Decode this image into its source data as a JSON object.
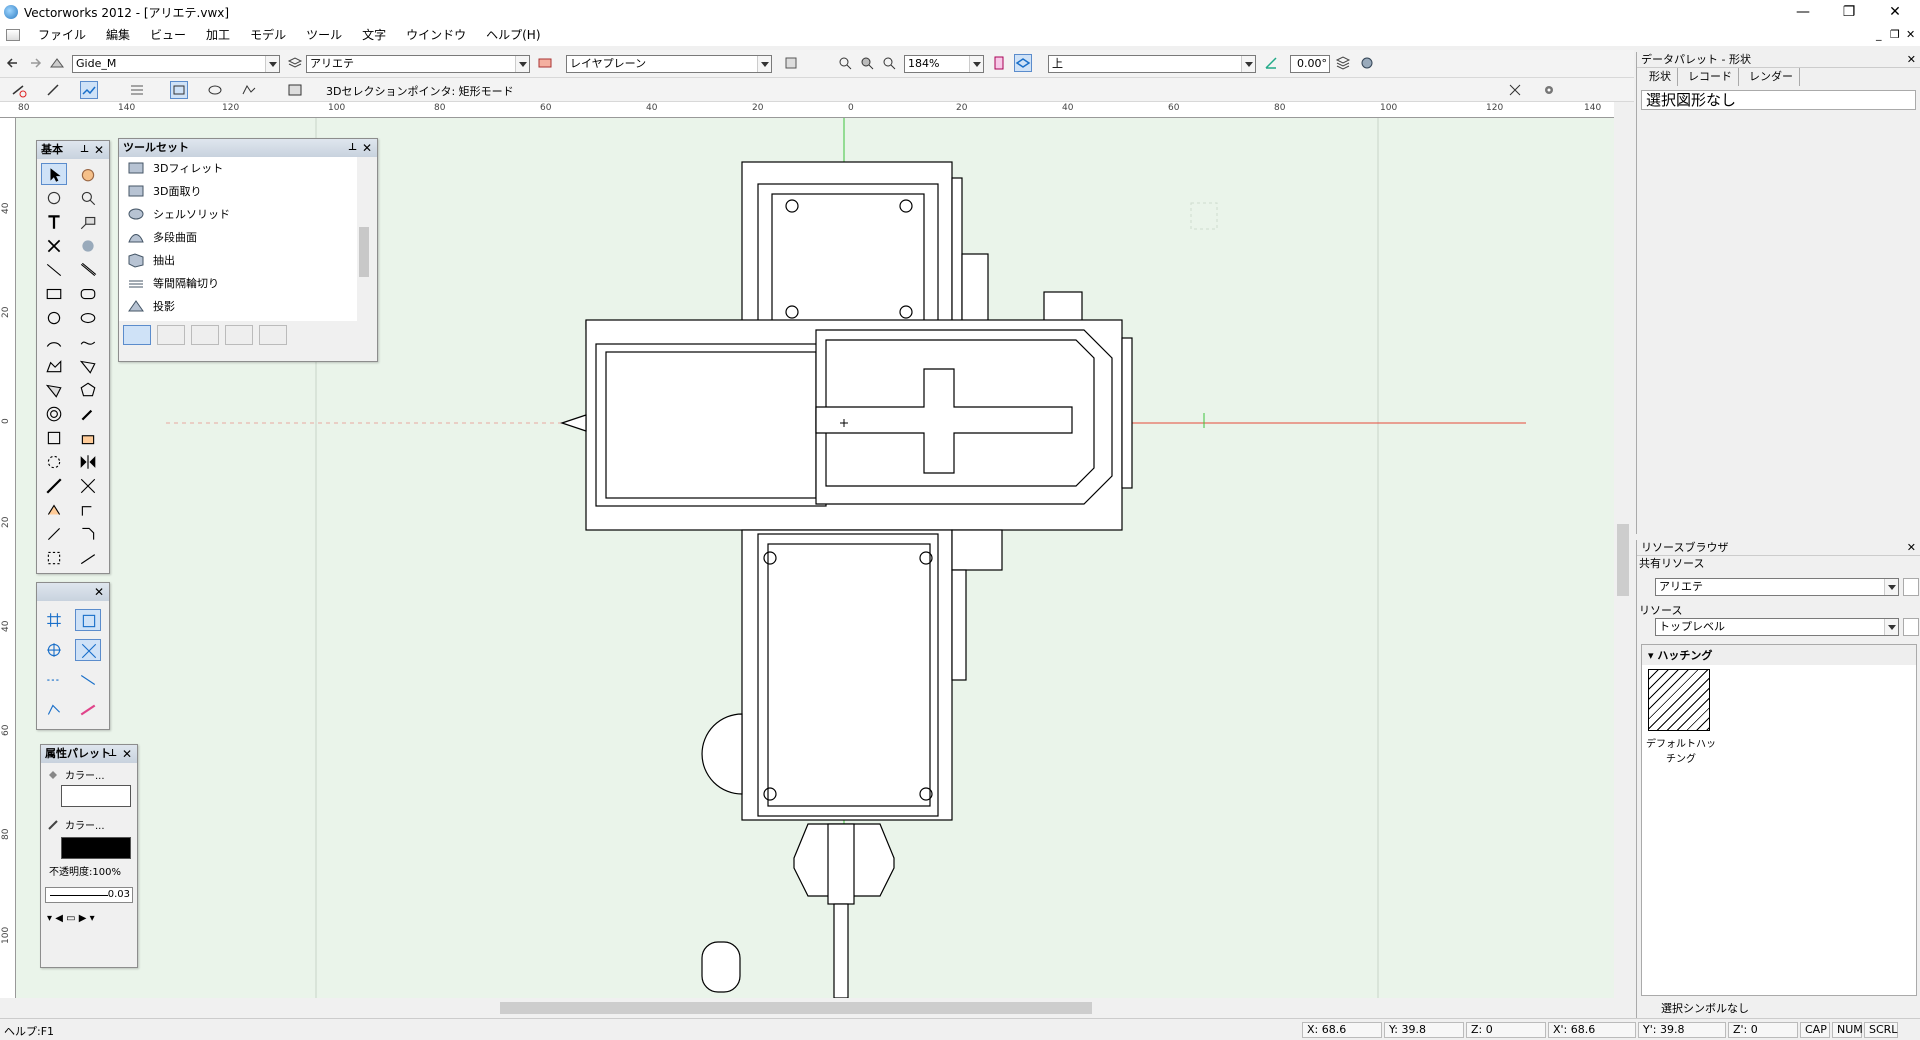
{
  "window": {
    "title": "Vectorworks 2012 - [アリエテ.vwx]",
    "minimize": "—",
    "restore": "❐",
    "close": "✕"
  },
  "menubar": {
    "items": [
      "ファイル",
      "編集",
      "ビュー",
      "加工",
      "モデル",
      "ツール",
      "文字",
      "ウインドウ",
      "ヘルプ(H)"
    ],
    "doc_controls": [
      "_",
      "❐",
      "✕"
    ]
  },
  "view_bar": {
    "class_value": "Gide_M",
    "layer_value": "アリエテ",
    "plane_value": "レイヤプレーン",
    "zoom_value": "184%",
    "view_value": "上",
    "angle_value": "0.00°"
  },
  "mode_bar": {
    "mode_label": "3Dセレクションポインタ: 矩形モード"
  },
  "ruler": {
    "top_labels": [
      "80",
      "120",
      "100",
      "140",
      "80",
      "60",
      "40",
      "20",
      "0",
      "20",
      "40",
      "60",
      "80",
      "100",
      "120",
      "140"
    ],
    "left_labels": [
      "40",
      "20",
      "0",
      "20",
      "40",
      "60",
      "80",
      "100"
    ]
  },
  "palettes": {
    "basic": {
      "title": "基本"
    },
    "toolset": {
      "title": "ツールセット",
      "items": [
        "3Dフィレット",
        "3D面取り",
        "シェルソリッド",
        "多段曲面",
        "抽出",
        "等間隔輪切り",
        "投影"
      ]
    },
    "attributes": {
      "title": "属性パレット",
      "fill_label": "カラー...",
      "pen_label": "カラー...",
      "opacity_label": "不透明度:100%",
      "lineweight": "0.03"
    }
  },
  "data_palette": {
    "title": "データパレット - 形状",
    "tabs": [
      "形状",
      "レコード",
      "レンダー"
    ],
    "selection_text": "選択図形なし"
  },
  "resource_browser": {
    "title": "リソースブラウザ",
    "shared_label": "共有リソース",
    "shared_value": "アリエテ",
    "resource_label": "リソース",
    "resource_value": "トップレベル",
    "category": "ハッチング",
    "item_label": "デフォルトハッチング",
    "footer": "選択シンボルなし"
  },
  "status": {
    "help": "ヘルプ:F1",
    "x": "X: 68.6",
    "y": "Y: 39.8",
    "z": "Z: 0",
    "x2": "X': 68.6",
    "y2": "Y': 39.8",
    "z2": "Z': 0",
    "cap": "CAP",
    "num": "NUM",
    "scrl": "SCRL"
  },
  "colors": {
    "canvas_bg": "#eaf4ea",
    "axis_green": "#3ec43e",
    "axis_red": "#e64a3a",
    "selection_blue": "#cfe2f7"
  }
}
